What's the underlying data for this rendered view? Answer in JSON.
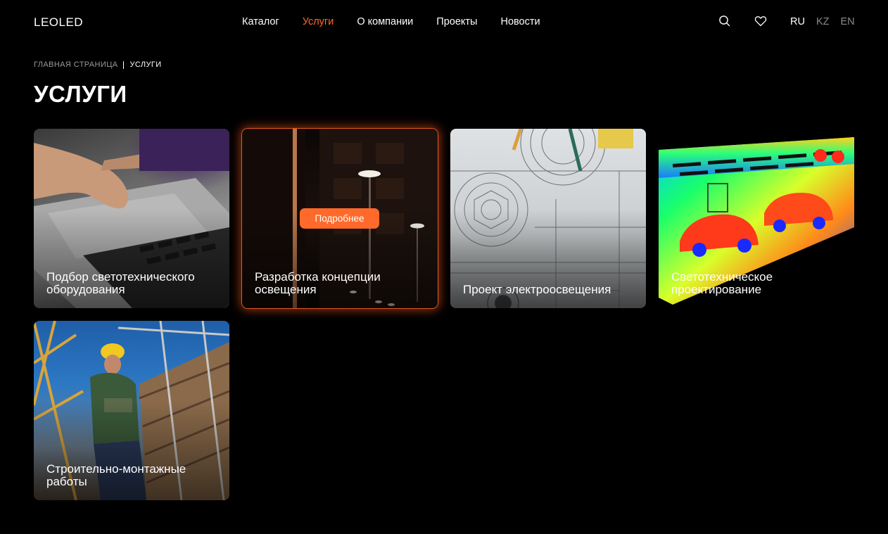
{
  "header": {
    "logo": "LEOLED",
    "nav": [
      {
        "label": "Каталог",
        "active": false
      },
      {
        "label": "Услуги",
        "active": true
      },
      {
        "label": "О компании",
        "active": false
      },
      {
        "label": "Проекты",
        "active": false
      },
      {
        "label": "Новости",
        "active": false
      }
    ],
    "icons": [
      "search-icon",
      "heart-icon"
    ],
    "langs": [
      {
        "label": "RU",
        "active": true
      },
      {
        "label": "KZ",
        "active": false
      },
      {
        "label": "EN",
        "active": false
      }
    ]
  },
  "breadcrumb": {
    "home": "ГЛАВНАЯ СТРАНИЦА",
    "current": "УСЛУГИ"
  },
  "page_title": "УСЛУГИ",
  "cards": [
    {
      "title": "Подбор светотехнического оборудования"
    },
    {
      "title": "Разработка концепции освещения",
      "button": "Подробнее"
    },
    {
      "title": "Проект электроосвещения"
    },
    {
      "title": "Светотехническое проектирование"
    },
    {
      "title": "Строительно-монтажные работы"
    }
  ],
  "colors": {
    "accent": "#ff6a2b",
    "background": "#000000",
    "muted": "#8a8a8a"
  }
}
